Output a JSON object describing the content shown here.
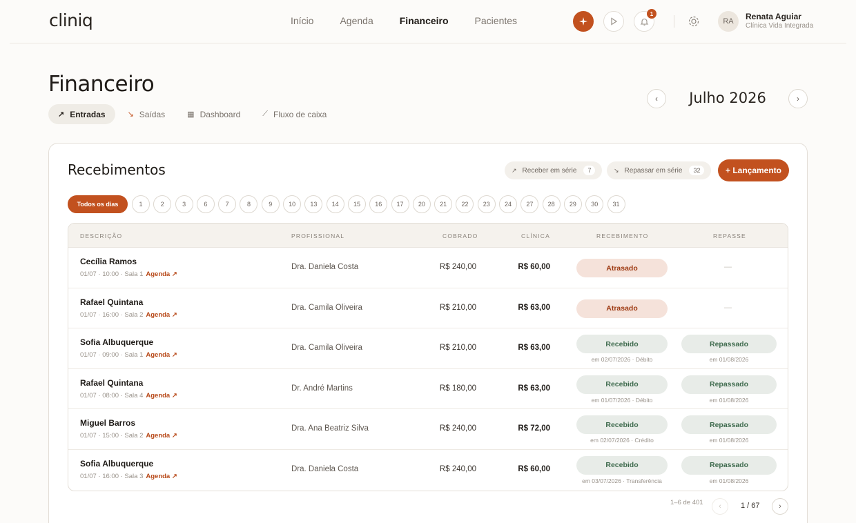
{
  "header": {
    "logo": "cliniq",
    "nav": [
      {
        "label": "Início",
        "active": false
      },
      {
        "label": "Agenda",
        "active": false
      },
      {
        "label": "Financeiro",
        "active": true
      },
      {
        "label": "Pacientes",
        "active": false
      }
    ],
    "notification_count": "1",
    "user": {
      "initials": "RA",
      "name": "Renata Aguiar",
      "clinic": "Clínica Vida Integrada"
    }
  },
  "page": {
    "title": "Financeiro",
    "tabs": [
      {
        "label": "Entradas",
        "icon": "arrow-up-right-icon",
        "active": true
      },
      {
        "label": "Saídas",
        "icon": "arrow-down-right-icon",
        "active": false
      },
      {
        "label": "Dashboard",
        "icon": "grid-icon",
        "active": false
      },
      {
        "label": "Fluxo de caixa",
        "icon": "line-chart-icon",
        "active": false
      }
    ],
    "month": "Julho 2026"
  },
  "card": {
    "title": "Recebimentos",
    "receber_label": "Receber em série",
    "receber_count": "7",
    "repassar_label": "Repassar em série",
    "repassar_count": "32",
    "add_label": "+ Lançamento",
    "all_days_label": "Todos os dias",
    "days": [
      "1",
      "2",
      "3",
      "6",
      "7",
      "8",
      "9",
      "10",
      "13",
      "14",
      "15",
      "16",
      "17",
      "20",
      "21",
      "22",
      "23",
      "24",
      "27",
      "28",
      "29",
      "30",
      "31"
    ]
  },
  "table": {
    "headers": [
      "DESCRIÇÃO",
      "PROFISSIONAL",
      "COBRADO",
      "CLÍNICA",
      "RECEBIMENTO",
      "REPASSE"
    ],
    "agenda_label": "Agenda ↗",
    "rows": [
      {
        "name": "Cecília Ramos",
        "meta": "01/07 · 10:00 · Sala 1",
        "prof": "Dra. Daniela Costa",
        "cobrado": "R$ 240,00",
        "clinica": "R$ 60,00",
        "status": "Atrasado",
        "status_type": "late",
        "status_sub": "",
        "repasse": "",
        "repasse_sub": "",
        "repasse_empty": "—"
      },
      {
        "name": "Rafael Quintana",
        "meta": "01/07 · 16:00 · Sala 2",
        "prof": "Dra. Camila Oliveira",
        "cobrado": "R$ 210,00",
        "clinica": "R$ 63,00",
        "status": "Atrasado",
        "status_type": "late",
        "status_sub": "",
        "repasse": "",
        "repasse_sub": "",
        "repasse_empty": "—"
      },
      {
        "name": "Sofia Albuquerque",
        "meta": "01/07 · 09:00 · Sala 1",
        "prof": "Dra. Camila Oliveira",
        "cobrado": "R$ 210,00",
        "clinica": "R$ 63,00",
        "status": "Recebido",
        "status_type": "ok",
        "status_sub": "em 02/07/2026 · Débito",
        "repasse": "Repassado",
        "repasse_sub": "em 01/08/2026",
        "repasse_empty": ""
      },
      {
        "name": "Rafael Quintana",
        "meta": "01/07 · 08:00 · Sala 4",
        "prof": "Dr. André Martins",
        "cobrado": "R$ 180,00",
        "clinica": "R$ 63,00",
        "status": "Recebido",
        "status_type": "ok",
        "status_sub": "em 01/07/2026 · Débito",
        "repasse": "Repassado",
        "repasse_sub": "em 01/08/2026",
        "repasse_empty": ""
      },
      {
        "name": "Miguel Barros",
        "meta": "01/07 · 15:00 · Sala 2",
        "prof": "Dra. Ana Beatriz Silva",
        "cobrado": "R$ 240,00",
        "clinica": "R$ 72,00",
        "status": "Recebido",
        "status_type": "ok",
        "status_sub": "em 02/07/2026 · Crédito",
        "repasse": "Repassado",
        "repasse_sub": "em 01/08/2026",
        "repasse_empty": ""
      },
      {
        "name": "Sofia Albuquerque",
        "meta": "01/07 · 16:00 · Sala 3",
        "prof": "Dra. Daniela Costa",
        "cobrado": "R$ 240,00",
        "clinica": "R$ 60,00",
        "status": "Recebido",
        "status_type": "ok",
        "status_sub": "em 03/07/2026 · Transferência",
        "repasse": "Repassado",
        "repasse_sub": "em 01/08/2026",
        "repasse_empty": ""
      }
    ]
  },
  "pagination": {
    "range": "1–6 de 401",
    "current": "1 / 67"
  },
  "colors": {
    "accent": "#c2511f",
    "late_bg": "#f5e2da",
    "ok_bg": "#e8ece8"
  }
}
